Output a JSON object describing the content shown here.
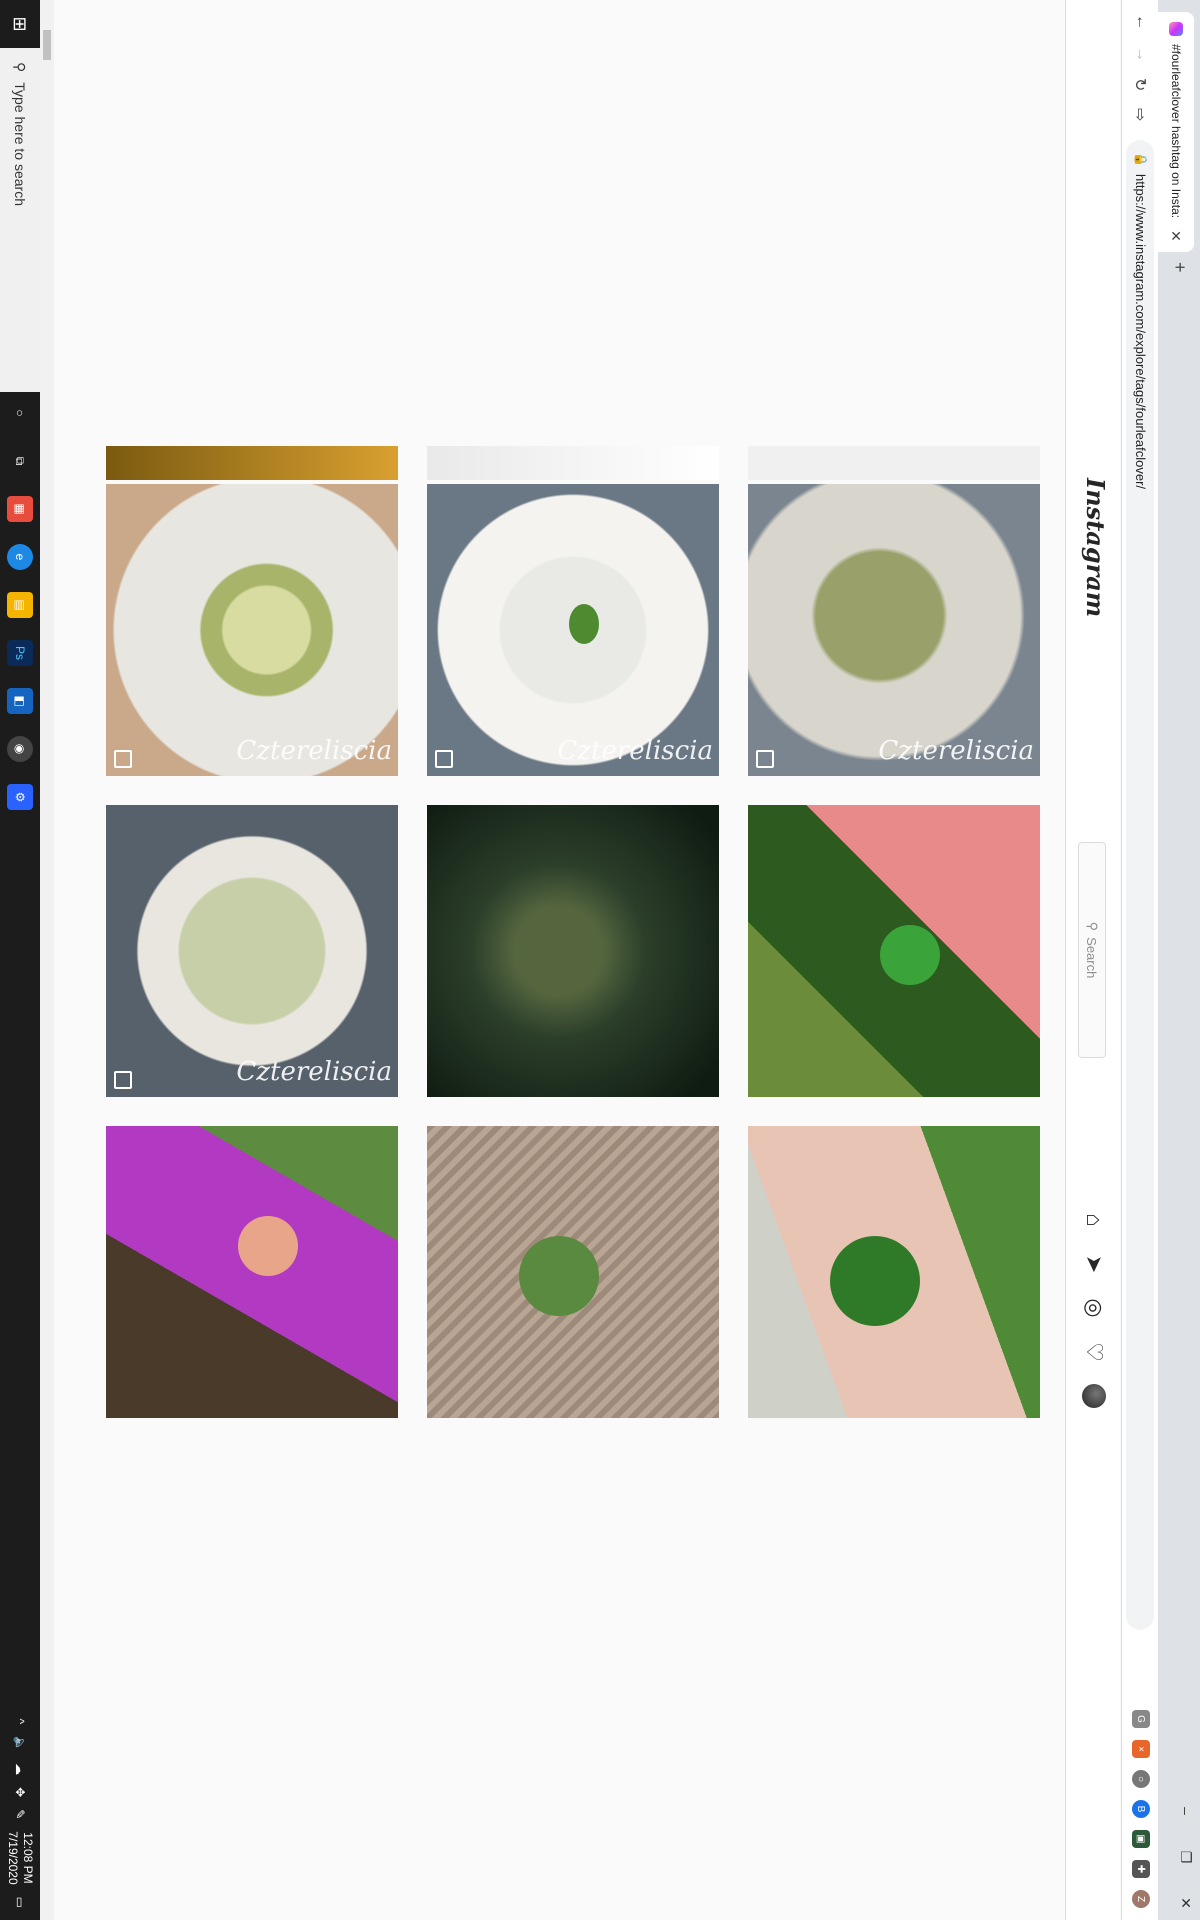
{
  "browser": {
    "tab_title": "#fourleafclover hashtag on Insta:",
    "tab_close": "✕",
    "new_tab": "+",
    "url": "https://www.instagram.com/explore/tags/fourleafclover/",
    "window_controls": [
      "–",
      "❐",
      "✕"
    ],
    "nav_icons": [
      "arrow-left-icon",
      "arrow-right-icon",
      "reload-icon",
      "share-icon"
    ]
  },
  "instagram": {
    "logo": "Instagram",
    "search_placeholder": "Search",
    "nav_icons": [
      "home-icon",
      "direct-icon",
      "explore-icon",
      "heart-icon",
      "avatar"
    ]
  },
  "grid": {
    "posts": [
      {
        "desc": "resin",
        "watermark": "Cztereliscia",
        "multi": true
      },
      {
        "desc": "hand-clover",
        "watermark": "",
        "multi": false
      },
      {
        "desc": "palm-clover",
        "watermark": "",
        "multi": false
      },
      {
        "desc": "necklace",
        "watermark": "Cztereliscia",
        "multi": true
      },
      {
        "desc": "ant",
        "watermark": "",
        "multi": false
      },
      {
        "desc": "pinch",
        "watermark": "",
        "multi": false
      },
      {
        "desc": "drop",
        "watermark": "Cztereliscia",
        "multi": true
      },
      {
        "desc": "dish",
        "watermark": "Cztereliscia",
        "multi": true
      },
      {
        "desc": "flowers",
        "watermark": "",
        "multi": false
      }
    ]
  },
  "taskbar": {
    "search_placeholder": "Type here to search",
    "time": "12:08 PM",
    "date": "7/19/2020"
  },
  "colors": {
    "taskbar": "#1c1c1c",
    "ig_border": "#dbdbdb",
    "tab_strip": "#dee1e6"
  }
}
